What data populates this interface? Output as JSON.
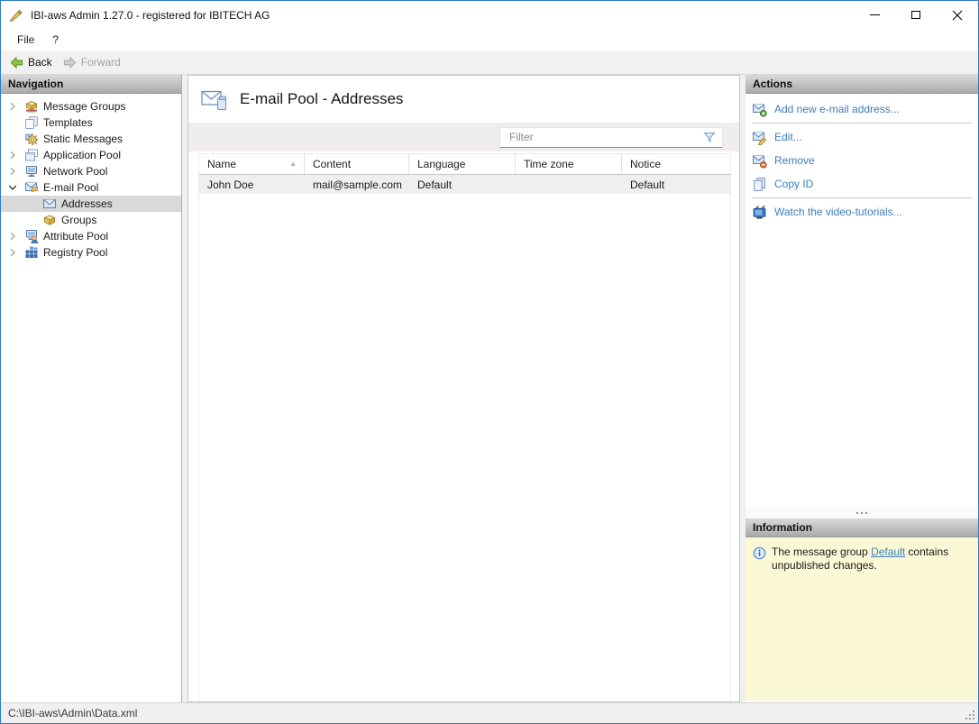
{
  "window": {
    "title": "IBI-aws Admin 1.27.0 - registered for IBITECH AG"
  },
  "menu": {
    "items": [
      {
        "label": "File"
      },
      {
        "label": "?"
      }
    ]
  },
  "toolbar": {
    "back_label": "Back",
    "forward_label": "Forward"
  },
  "navigation": {
    "header": "Navigation",
    "items": [
      {
        "label": "Message Groups",
        "icon": "message-groups-icon",
        "expand": "collapsed",
        "level": 0,
        "selected": false
      },
      {
        "label": "Templates",
        "icon": "templates-icon",
        "expand": "none",
        "level": 0,
        "selected": false
      },
      {
        "label": "Static Messages",
        "icon": "static-messages-icon",
        "expand": "none",
        "level": 0,
        "selected": false
      },
      {
        "label": "Application Pool",
        "icon": "application-pool-icon",
        "expand": "collapsed",
        "level": 0,
        "selected": false
      },
      {
        "label": "Network Pool",
        "icon": "network-pool-icon",
        "expand": "collapsed",
        "level": 0,
        "selected": false
      },
      {
        "label": "E-mail Pool",
        "icon": "email-pool-icon",
        "expand": "expanded",
        "level": 0,
        "selected": false
      },
      {
        "label": "Addresses",
        "icon": "envelope-icon",
        "expand": "none",
        "level": 1,
        "selected": true
      },
      {
        "label": "Groups",
        "icon": "package-icon",
        "expand": "none",
        "level": 1,
        "selected": false
      },
      {
        "label": "Attribute Pool",
        "icon": "attribute-pool-icon",
        "expand": "collapsed",
        "level": 0,
        "selected": false
      },
      {
        "label": "Registry Pool",
        "icon": "registry-pool-icon",
        "expand": "collapsed",
        "level": 0,
        "selected": false
      }
    ]
  },
  "content": {
    "title": "E-mail Pool - Addresses",
    "title_icon": "envelope-page-icon",
    "filter_placeholder": "Filter",
    "table": {
      "columns": [
        "Name",
        "Content",
        "Language",
        "Time zone",
        "Notice"
      ],
      "sorted_column_index": 0,
      "sort_direction": "ascending",
      "rows": [
        [
          "John Doe",
          "mail@sample.com",
          "Default",
          "",
          "Default",
          ""
        ]
      ]
    }
  },
  "actions": {
    "header": "Actions",
    "items": [
      {
        "label": "Add new e-mail address...",
        "icon": "envelope-add-icon",
        "separator_after": true
      },
      {
        "label": "Edit...",
        "icon": "envelope-edit-icon",
        "separator_after": false
      },
      {
        "label": "Remove",
        "icon": "envelope-remove-icon",
        "separator_after": false
      },
      {
        "label": "Copy ID",
        "icon": "copy-icon",
        "separator_after": true
      },
      {
        "label": "Watch the video-tutorials...",
        "icon": "tv-icon",
        "separator_after": false
      }
    ]
  },
  "information": {
    "header": "Information",
    "text_before": "The message group ",
    "link_label": "Default",
    "text_after": " contains unpublished changes."
  },
  "statusbar": {
    "path": "C:\\IBI-aws\\Admin\\Data.xml"
  },
  "colors": {
    "link_blue": "#3c7dbd",
    "info_background": "#fbf9d5",
    "selection_gray": "#d9d9d9",
    "header_gradient_top": "#dadada",
    "header_gradient_bottom": "#aaaaaa"
  }
}
